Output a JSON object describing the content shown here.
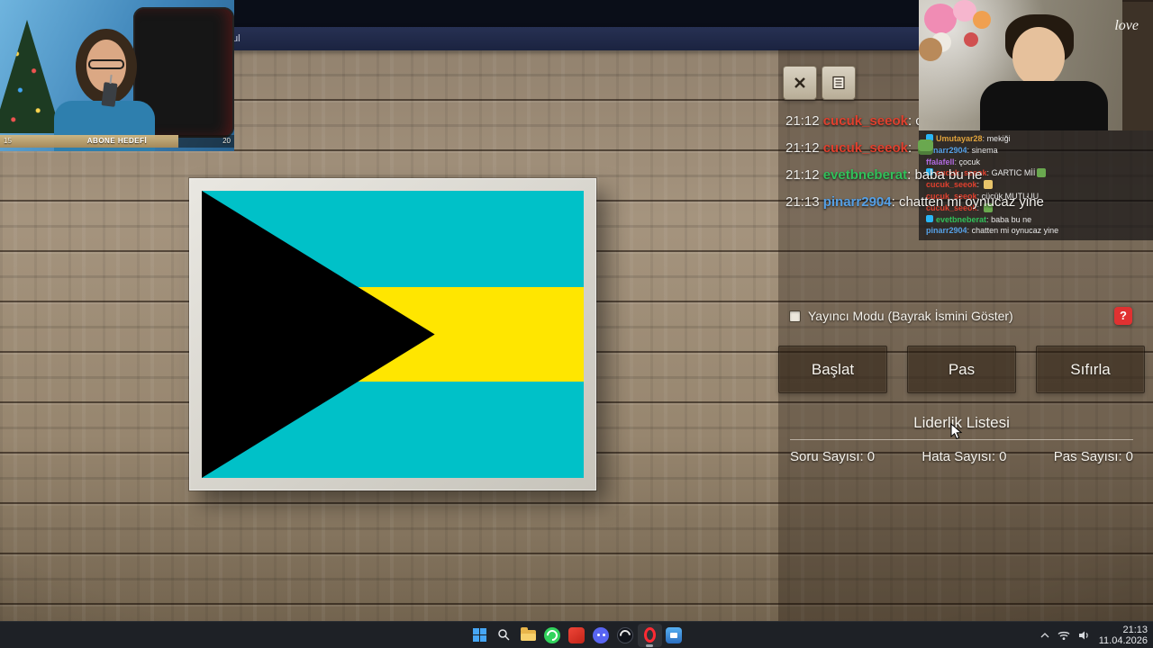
{
  "window": {
    "tab_fragment": "ul"
  },
  "left_webcam": {
    "goal_label": "ABONE HEDEFİ",
    "goal_current": "15",
    "goal_target": "20",
    "goal_progress": "76%"
  },
  "right_webcam": {
    "decor_text": "love"
  },
  "chat": {
    "separator": ":",
    "messages": [
      {
        "time": "21:12",
        "user": "cucuk_seeok",
        "color": "#e0402e",
        "text": "cücü",
        "emote": "",
        "emote_display": ""
      },
      {
        "time": "21:12",
        "user": "cucuk_seeok",
        "color": "#e0402e",
        "text": "",
        "emote": "#6aa84f",
        "emote_display": "inline-block"
      },
      {
        "time": "21:12",
        "user": "evetbneberat",
        "color": "#31c05a",
        "text": "baba bu ne",
        "emote": "",
        "emote_display": ""
      },
      {
        "time": "21:13",
        "user": "pinarr2904",
        "color": "#55a0e6",
        "text": "chatten mi oynucaz yine",
        "emote": "",
        "emote_display": ""
      }
    ]
  },
  "overlay_chat": {
    "separator": ":",
    "messages": [
      {
        "user": "Umutayar28",
        "color": "#e0a33c",
        "text": "mekiği",
        "badge": "#29b6f6",
        "badge_display": "inline-block",
        "emote": "",
        "emote_display": ""
      },
      {
        "user": "pinarr2904",
        "color": "#55a0e6",
        "text": "sinema",
        "badge": "",
        "badge_display": "",
        "emote": "",
        "emote_display": ""
      },
      {
        "user": "ffalafell",
        "color": "#b06ae0",
        "text": "çocuk",
        "badge": "",
        "badge_display": "",
        "emote": "",
        "emote_display": ""
      },
      {
        "user": "cucuk_seeok",
        "color": "#e0402e",
        "text": "GARTIC Mİİ",
        "badge": "#29b6f6",
        "badge_display": "inline-block",
        "emote": "#6aa84f",
        "emote_display": "inline-block"
      },
      {
        "user": "cucuk_seeok",
        "color": "#e0402e",
        "text": "",
        "badge": "",
        "badge_display": "",
        "emote": "#e8c46a",
        "emote_display": "inline-block"
      },
      {
        "user": "cucuk_seeok",
        "color": "#e0402e",
        "text": "cücük MUTLUU",
        "badge": "",
        "badge_display": "",
        "emote": "",
        "emote_display": ""
      },
      {
        "user": "cucuk_seeok",
        "color": "#e0402e",
        "text": "",
        "badge": "",
        "badge_display": "",
        "emote": "#6aa84f",
        "emote_display": "inline-block"
      },
      {
        "user": "evetbneberat",
        "color": "#31c05a",
        "text": "baba bu ne",
        "badge": "#29b6f6",
        "badge_display": "inline-block",
        "emote": "",
        "emote_display": ""
      },
      {
        "user": "pinarr2904",
        "color": "#55a0e6",
        "text": "chatten mi oynucaz yine",
        "badge": "",
        "badge_display": "",
        "emote": "",
        "emote_display": ""
      }
    ]
  },
  "controls": {
    "streamer_mode_label": "Yayıncı Modu (Bayrak İsmini Göster)",
    "help_label": "?",
    "start_label": "Başlat",
    "pass_label": "Pas",
    "reset_label": "Sıfırla"
  },
  "leaderboard": {
    "title": "Liderlik Listesi",
    "stats": [
      {
        "label": "Soru Sayısı:",
        "value": "0"
      },
      {
        "label": "Hata Sayısı:",
        "value": "0"
      },
      {
        "label": "Pas Sayısı:",
        "value": "0"
      }
    ]
  },
  "flag": {
    "country": "Bahamas",
    "aqua": "#00c1c8",
    "yellow": "#ffe600",
    "black": "#000000"
  },
  "taskbar": {
    "time": "21:13",
    "date": "11.04.2026"
  }
}
